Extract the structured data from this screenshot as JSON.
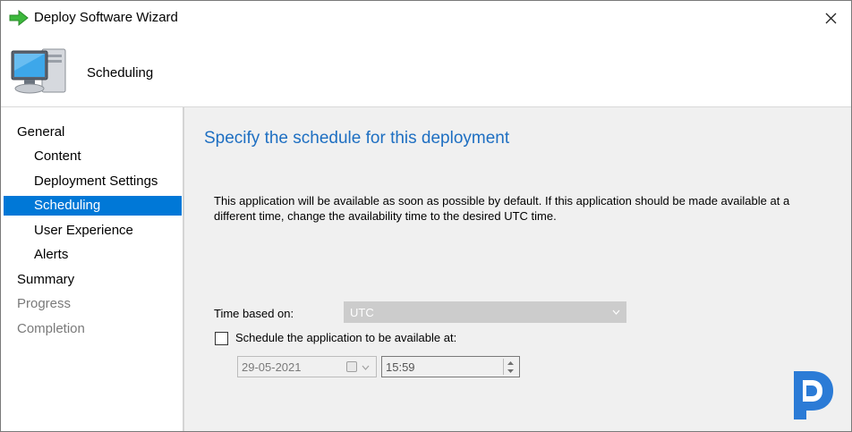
{
  "window": {
    "title": "Deploy Software Wizard",
    "close_icon": "close-icon",
    "app_icon": "green-arrow-icon"
  },
  "header": {
    "title": "Scheduling",
    "icon": "computer-icon"
  },
  "nav": {
    "items": [
      {
        "label": "General",
        "level": 0,
        "state": "normal"
      },
      {
        "label": "Content",
        "level": 1,
        "state": "normal"
      },
      {
        "label": "Deployment Settings",
        "level": 1,
        "state": "normal"
      },
      {
        "label": "Scheduling",
        "level": 1,
        "state": "active"
      },
      {
        "label": "User Experience",
        "level": 1,
        "state": "normal"
      },
      {
        "label": "Alerts",
        "level": 1,
        "state": "normal"
      },
      {
        "label": "Summary",
        "level": 0,
        "state": "normal"
      },
      {
        "label": "Progress",
        "level": 0,
        "state": "disabled"
      },
      {
        "label": "Completion",
        "level": 0,
        "state": "disabled"
      }
    ]
  },
  "main": {
    "heading": "Specify the schedule for this deployment",
    "description": "This application will be available as soon as possible by default. If this application should be made available at a different time, change the availability time to the desired UTC time.",
    "time_based_on": {
      "label": "Time based on:",
      "value": "UTC"
    },
    "schedule": {
      "checkbox_label": "Schedule the application to be available at:",
      "checked": false,
      "date": "29-05-2021",
      "time": "15:59"
    }
  },
  "colors": {
    "accent": "#0078d7",
    "heading": "#1e6fc2",
    "content_bg": "#f0f0f0"
  }
}
